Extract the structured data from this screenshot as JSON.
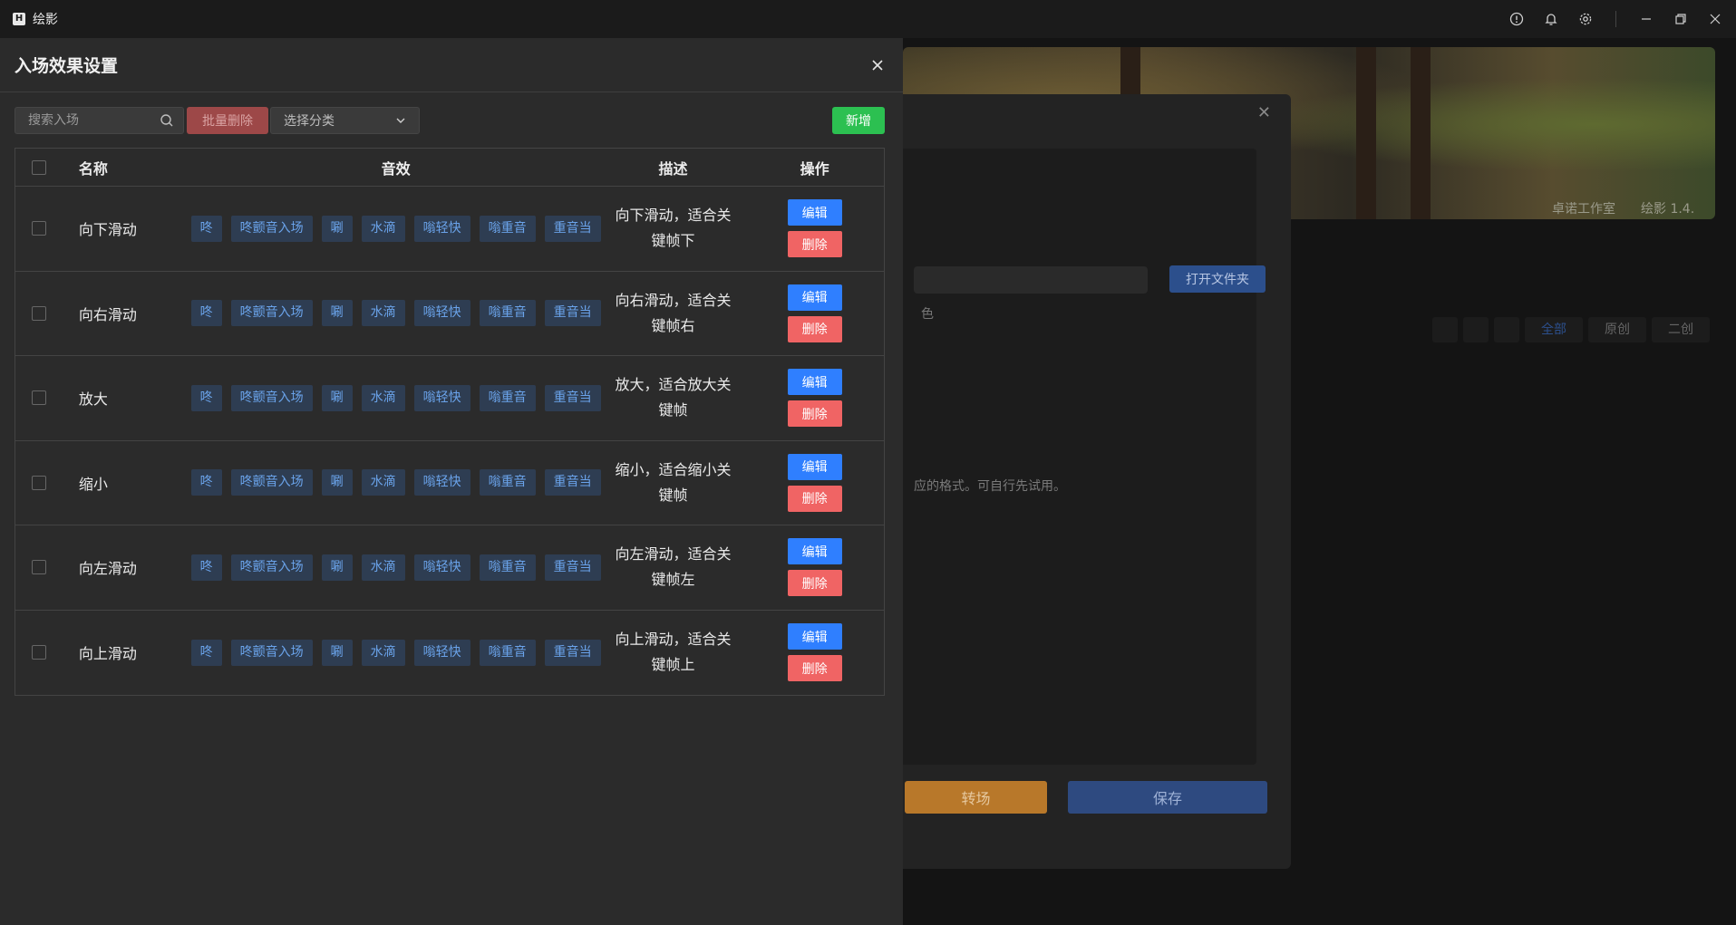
{
  "app": {
    "logo": "H",
    "title": "绘影"
  },
  "background": {
    "banner_studio": "卓诺工作室",
    "banner_version": "绘影 1.4.",
    "open_folder": "打开文件夹",
    "fragment": "色",
    "hint": "应的格式。可自行先试用。",
    "transition_button": "转场",
    "save_button": "保存",
    "tabs": [
      "全部",
      "原创",
      "二创"
    ]
  },
  "drawer": {
    "title": "入场效果设置",
    "search_placeholder": "搜索入场",
    "batch_delete": "批量删除",
    "category_placeholder": "选择分类",
    "add_button": "新增",
    "columns": {
      "name": "名称",
      "audio": "音效",
      "desc": "描述",
      "ops": "操作"
    },
    "edit_label": "编辑",
    "delete_label": "删除",
    "rows": [
      {
        "name": "向下滑动",
        "tags": [
          "咚",
          "咚颤音入场",
          "唰",
          "水滴",
          "嗡轻快",
          "嗡重音",
          "重音当"
        ],
        "desc": "向下滑动，适合关键帧下"
      },
      {
        "name": "向右滑动",
        "tags": [
          "咚",
          "咚颤音入场",
          "唰",
          "水滴",
          "嗡轻快",
          "嗡重音",
          "重音当"
        ],
        "desc": "向右滑动，适合关键帧右"
      },
      {
        "name": "放大",
        "tags": [
          "咚",
          "咚颤音入场",
          "唰",
          "水滴",
          "嗡轻快",
          "嗡重音",
          "重音当"
        ],
        "desc": "放大，适合放大关键帧"
      },
      {
        "name": "缩小",
        "tags": [
          "咚",
          "咚颤音入场",
          "唰",
          "水滴",
          "嗡轻快",
          "嗡重音",
          "重音当"
        ],
        "desc": "缩小，适合缩小关键帧"
      },
      {
        "name": "向左滑动",
        "tags": [
          "咚",
          "咚颤音入场",
          "唰",
          "水滴",
          "嗡轻快",
          "嗡重音",
          "重音当"
        ],
        "desc": "向左滑动，适合关键帧左"
      },
      {
        "name": "向上滑动",
        "tags": [
          "咚",
          "咚颤音入场",
          "唰",
          "水滴",
          "嗡轻快",
          "嗡重音",
          "重音当"
        ],
        "desc": "向上滑动，适合关键帧上"
      }
    ]
  },
  "colors": {
    "accent_blue": "#2f7fff",
    "danger": "#f06464",
    "success": "#2cc051",
    "tag_text": "#6aa3ea"
  }
}
